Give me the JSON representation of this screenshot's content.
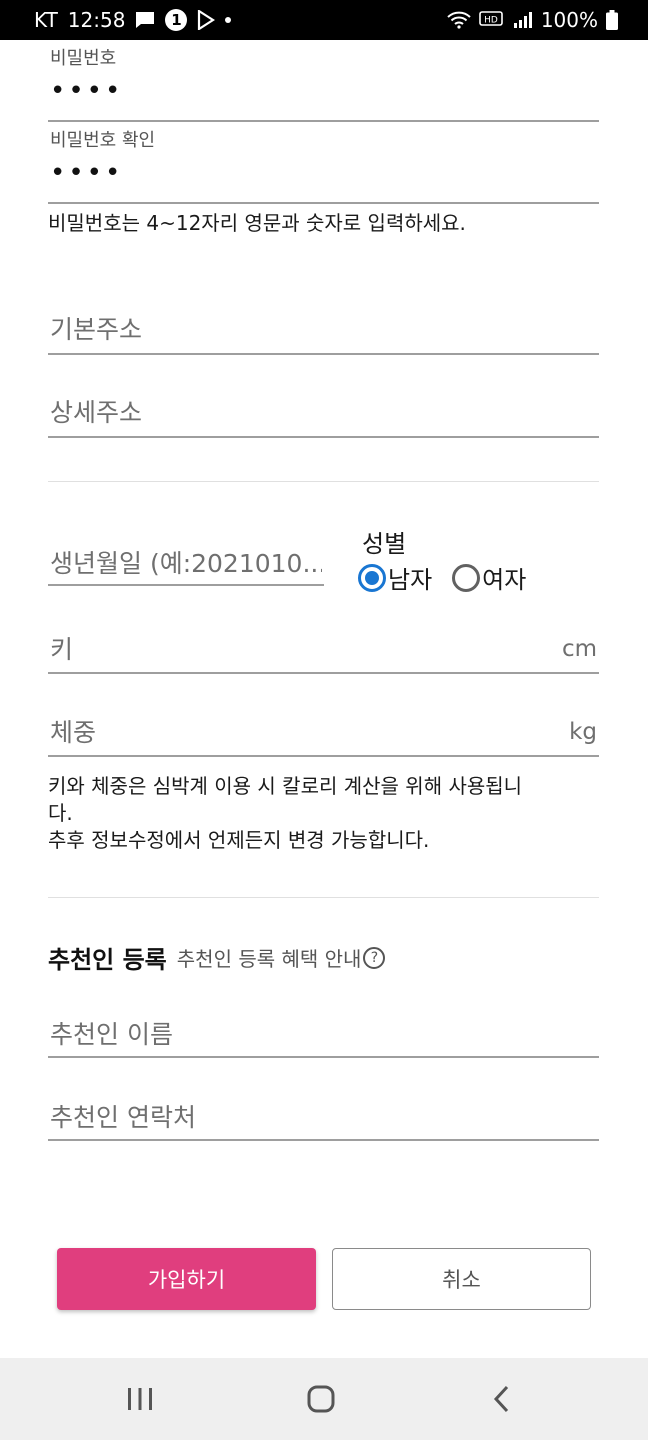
{
  "status_bar": {
    "carrier": "KT",
    "time": "12:58",
    "notification_count": "1",
    "hd_label": "HD",
    "battery": "100%"
  },
  "form": {
    "password": {
      "label": "비밀번호",
      "value": "••••"
    },
    "password_confirm": {
      "label": "비밀번호 확인",
      "value": "••••"
    },
    "password_help": "비밀번호는 4~12자리 영문과 숫자로 입력하세요.",
    "address_basic": {
      "placeholder": "기본주소"
    },
    "address_detail": {
      "placeholder": "상세주소"
    },
    "birthdate": {
      "placeholder": "생년월일 (예:2021010..."
    },
    "gender": {
      "title": "성별",
      "options": [
        {
          "label": "남자",
          "checked": true
        },
        {
          "label": "여자",
          "checked": false
        }
      ]
    },
    "height": {
      "placeholder": "키",
      "unit": "cm"
    },
    "weight": {
      "placeholder": "체중",
      "unit": "kg"
    },
    "body_help_line1": "키와 체중은 심박계 이용 시 칼로리 계산을 위해 사용됩니",
    "body_help_line2": "다.",
    "body_help_line3": "추후 정보수정에서 언제든지 변경 가능합니다.",
    "referrer": {
      "title": "추천인 등록",
      "info_link": "추천인 등록 혜택 안내",
      "name": {
        "placeholder": "추천인 이름"
      },
      "contact": {
        "placeholder": "추천인 연락처"
      }
    }
  },
  "actions": {
    "signup_label": "가입하기",
    "cancel_label": "취소"
  },
  "colors": {
    "primary": "#e03e7e",
    "radio_checked": "#1976d2"
  }
}
